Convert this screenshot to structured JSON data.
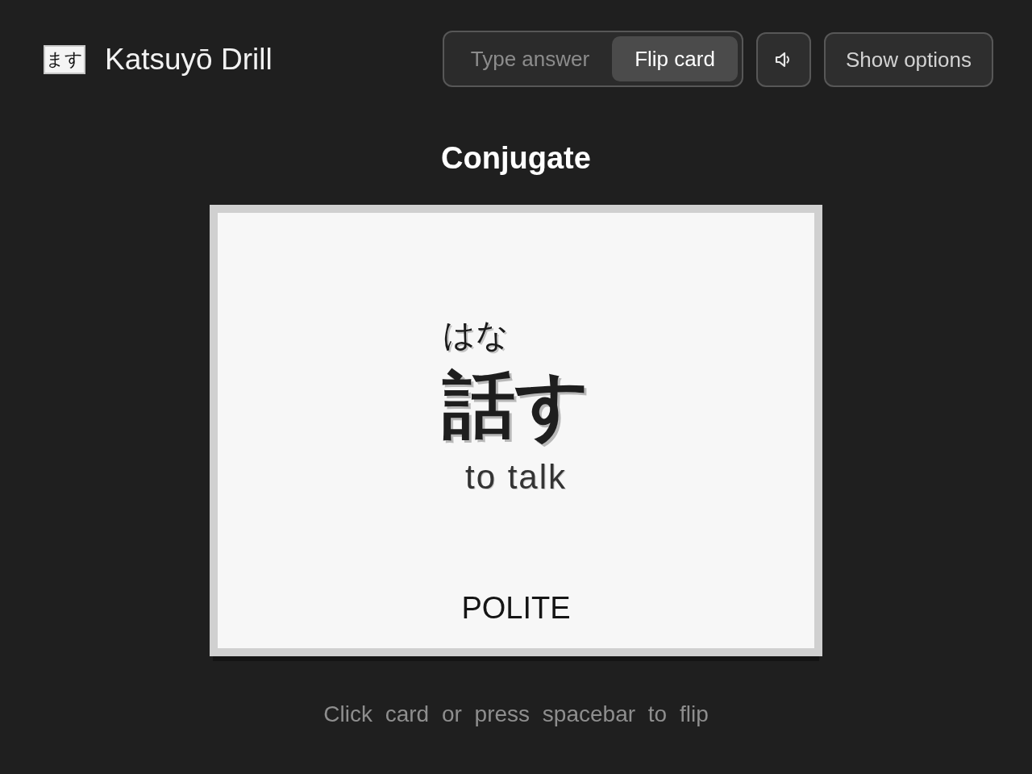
{
  "app": {
    "logo": "ます",
    "title": "Katsuyō Drill"
  },
  "mode_toggle": [
    {
      "label": "Type answer",
      "selected": false
    },
    {
      "label": "Flip card",
      "selected": true
    }
  ],
  "options_button": {
    "label": "Show options"
  },
  "heading": "Conjugate",
  "card": {
    "reading": "はな",
    "word": "話す",
    "meaning": "to talk",
    "form": "POLITE"
  },
  "hint": "Click card or press spacebar to flip"
}
